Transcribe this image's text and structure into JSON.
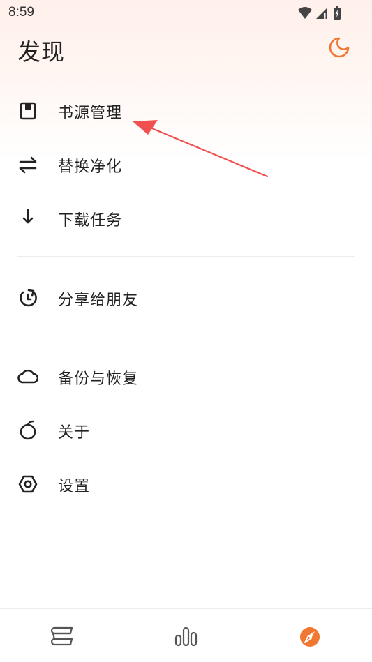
{
  "status": {
    "time": "8:59"
  },
  "title": "发现",
  "menu": {
    "book_source": "书源管理",
    "replace": "替换净化",
    "download": "下载任务",
    "share": "分享给朋友",
    "backup": "备份与恢复",
    "about": "关于",
    "settings": "设置"
  },
  "colors": {
    "accent": "#f07832",
    "arrow": "#f0504f",
    "text": "#222222"
  }
}
